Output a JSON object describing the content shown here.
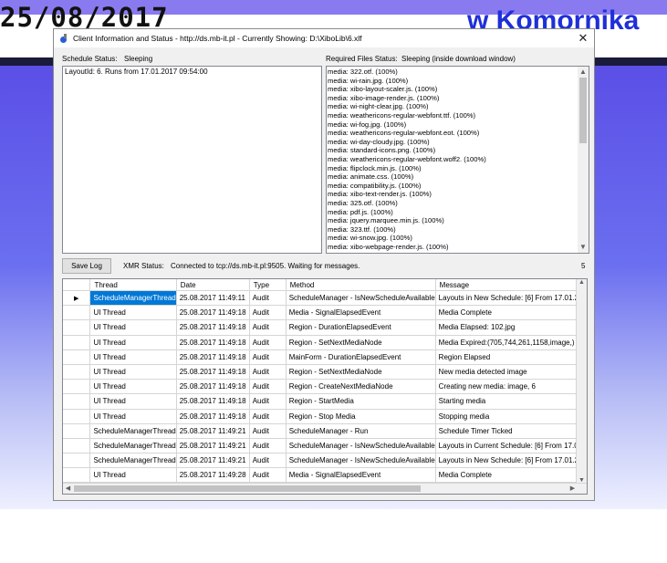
{
  "background": {
    "date_text": "25/08/2017",
    "title_text": "w Komornika"
  },
  "window": {
    "title": "Client Information and Status - http://ds.mb-it.pl - Currently Showing: D:\\XiboLib\\6.xlf",
    "close_glyph": "✕"
  },
  "schedule": {
    "status_label": "Schedule Status:",
    "status_value": "Sleeping",
    "text": "LayoutId: 6. Runs from 17.01.2017 09:54:00"
  },
  "required_files": {
    "status_label": "Required Files Status:",
    "status_value": "Sleeping (inside download window)",
    "items": [
      "media: 322.otf. (100%)",
      "media: wi-rain.jpg. (100%)",
      "media: xibo-layout-scaler.js. (100%)",
      "media: xibo-image-render.js. (100%)",
      "media: wi-night-clear.jpg. (100%)",
      "media: weathericons-regular-webfont.ttf. (100%)",
      "media: wi-fog.jpg. (100%)",
      "media: weathericons-regular-webfont.eot. (100%)",
      "media: wi-day-cloudy.jpg. (100%)",
      "media: standard-icons.png. (100%)",
      "media: weathericons-regular-webfont.woff2. (100%)",
      "media: flipclock.min.js. (100%)",
      "media: animate.css. (100%)",
      "media: compatibility.js. (100%)",
      "media: xibo-text-render.js. (100%)",
      "media: 325.otf. (100%)",
      "media: pdf.js. (100%)",
      "media: jquery.marquee.min.js. (100%)",
      "media: 323.ttf. (100%)",
      "media: wi-snow.jpg. (100%)",
      "media: xibo-webpage-render.js. (100%)"
    ]
  },
  "toolbar": {
    "save_log_label": "Save Log",
    "xmr_label": "XMR Status:",
    "xmr_value": "Connected to tcp://ds.mb-it.pl:9505. Waiting for messages.",
    "count": "5"
  },
  "log_grid": {
    "columns": [
      "Thread",
      "Date",
      "Type",
      "Method",
      "Message"
    ],
    "rows": [
      [
        "ScheduleManagerThread",
        "25.08.2017 11:49:11",
        "Audit",
        "ScheduleManager - IsNewScheduleAvailable",
        "Layouts in New Schedule: [6] From 17.01.20"
      ],
      [
        "UI Thread",
        "25.08.2017 11:49:18",
        "Audit",
        "Media - SignalElapsedEvent",
        "Media Complete"
      ],
      [
        "UI Thread",
        "25.08.2017 11:49:18",
        "Audit",
        "Region - DurationElapsedEvent",
        "Media Elapsed: 102.jpg"
      ],
      [
        "UI Thread",
        "25.08.2017 11:49:18",
        "Audit",
        "Region - SetNextMediaNode",
        "Media Expired:(705,744,261,1158,image,) . R"
      ],
      [
        "UI Thread",
        "25.08.2017 11:49:18",
        "Audit",
        "MainForm - DurationElapsedEvent",
        "Region Elapsed"
      ],
      [
        "UI Thread",
        "25.08.2017 11:49:18",
        "Audit",
        "Region - SetNextMediaNode",
        "New media detected image"
      ],
      [
        "UI Thread",
        "25.08.2017 11:49:18",
        "Audit",
        "Region - CreateNextMediaNode",
        "Creating new media: image, 6"
      ],
      [
        "UI Thread",
        "25.08.2017 11:49:18",
        "Audit",
        "Region - StartMedia",
        "Starting media"
      ],
      [
        "UI Thread",
        "25.08.2017 11:49:18",
        "Audit",
        "Region - Stop Media",
        "Stopping media"
      ],
      [
        "ScheduleManagerThread",
        "25.08.2017 11:49:21",
        "Audit",
        "ScheduleManager - Run",
        "Schedule Timer Ticked"
      ],
      [
        "ScheduleManagerThread",
        "25.08.2017 11:49:21",
        "Audit",
        "ScheduleManager - IsNewScheduleAvailable",
        "Layouts in Current Schedule: [6] From 17.01."
      ],
      [
        "ScheduleManagerThread",
        "25.08.2017 11:49:21",
        "Audit",
        "ScheduleManager - IsNewScheduleAvailable",
        "Layouts in New Schedule: [6] From 17.01.20"
      ],
      [
        "UI Thread",
        "25.08.2017 11:49:28",
        "Audit",
        "Media - SignalElapsedEvent",
        "Media Complete"
      ]
    ]
  }
}
